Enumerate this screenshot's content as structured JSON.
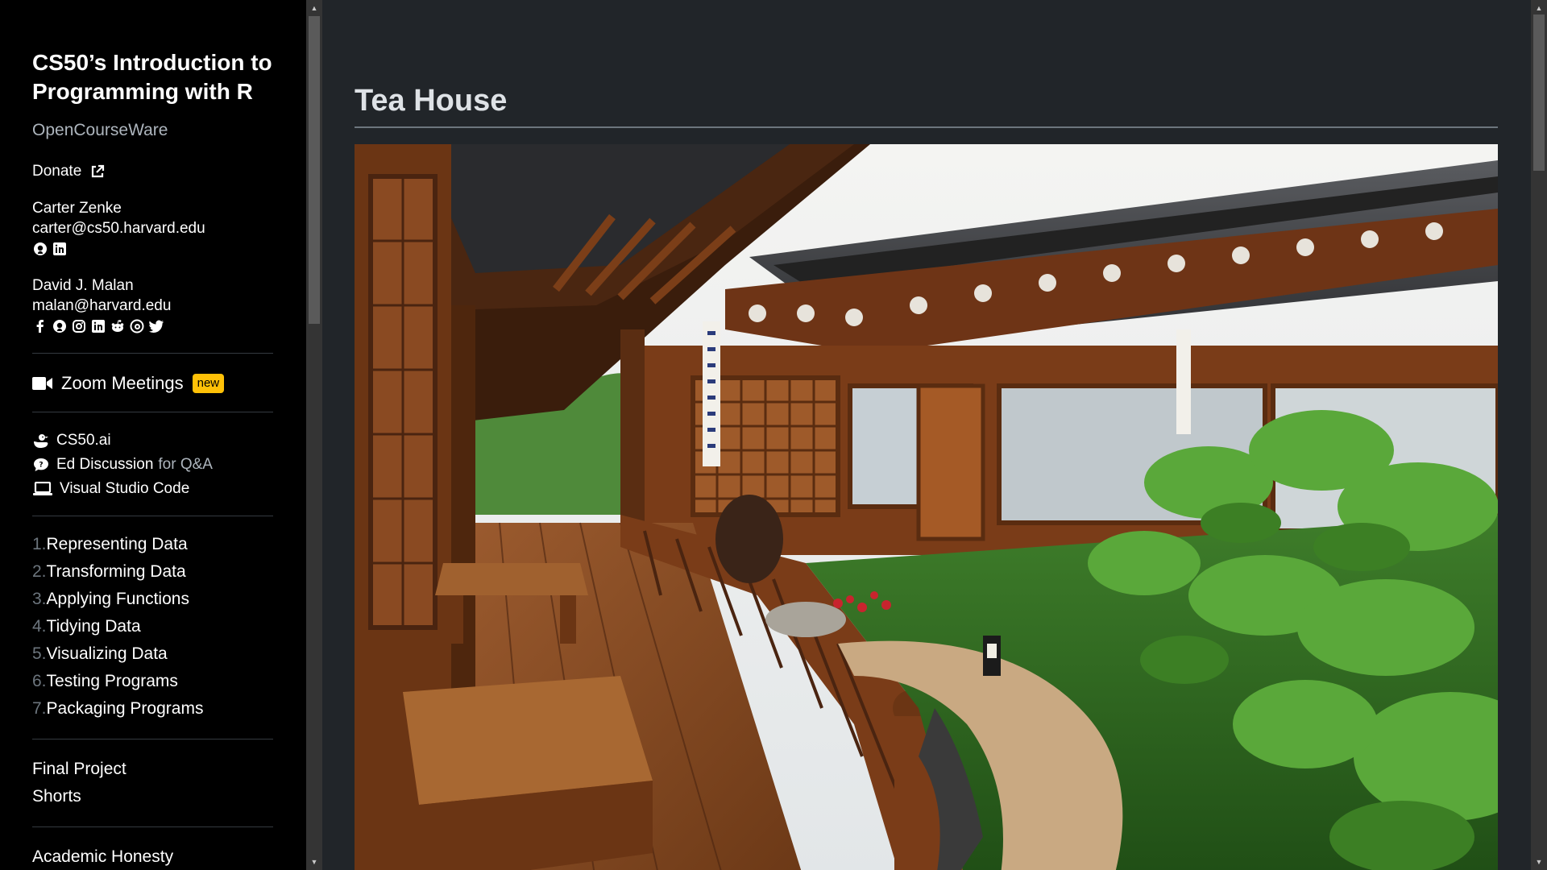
{
  "sidebar": {
    "course_title": "CS50’s Introduction to Programming with R",
    "subtitle": "OpenCourseWare",
    "donate_label": "Donate",
    "people": [
      {
        "name": "Carter Zenke",
        "email": "carter@cs50.harvard.edu",
        "icons": [
          "github-icon",
          "linkedin-icon"
        ]
      },
      {
        "name": "David J. Malan",
        "email": "malan@harvard.edu",
        "icons": [
          "facebook-icon",
          "github-icon",
          "instagram-icon",
          "linkedin-icon",
          "reddit-icon",
          "threads-icon",
          "twitter-icon"
        ]
      }
    ],
    "zoom": {
      "label": "Zoom Meetings",
      "badge": "new"
    },
    "tools": [
      {
        "label": "CS50.ai",
        "icon": "duck-icon"
      },
      {
        "label": "Ed Discussion",
        "suffix": "for Q&A",
        "icon": "chat-icon"
      },
      {
        "label": "Visual Studio Code",
        "icon": "laptop-icon"
      }
    ],
    "lectures": [
      {
        "num": "1.",
        "label": "Representing Data"
      },
      {
        "num": "2.",
        "label": "Transforming Data"
      },
      {
        "num": "3.",
        "label": "Applying Functions"
      },
      {
        "num": "4.",
        "label": "Tidying Data"
      },
      {
        "num": "5.",
        "label": "Visualizing Data"
      },
      {
        "num": "6.",
        "label": "Testing Programs"
      },
      {
        "num": "7.",
        "label": "Packaging Programs"
      }
    ],
    "misc": [
      "Final Project",
      "Shorts"
    ],
    "more": [
      "Academic Honesty"
    ]
  },
  "main": {
    "title": "Tea House",
    "image_subject": "Korean hanok tea house courtyard with wooden veranda, tiled roof and lotus garden"
  },
  "colors": {
    "sidebar_bg": "#000000",
    "main_bg": "#212529",
    "badge": "#ffc107"
  }
}
